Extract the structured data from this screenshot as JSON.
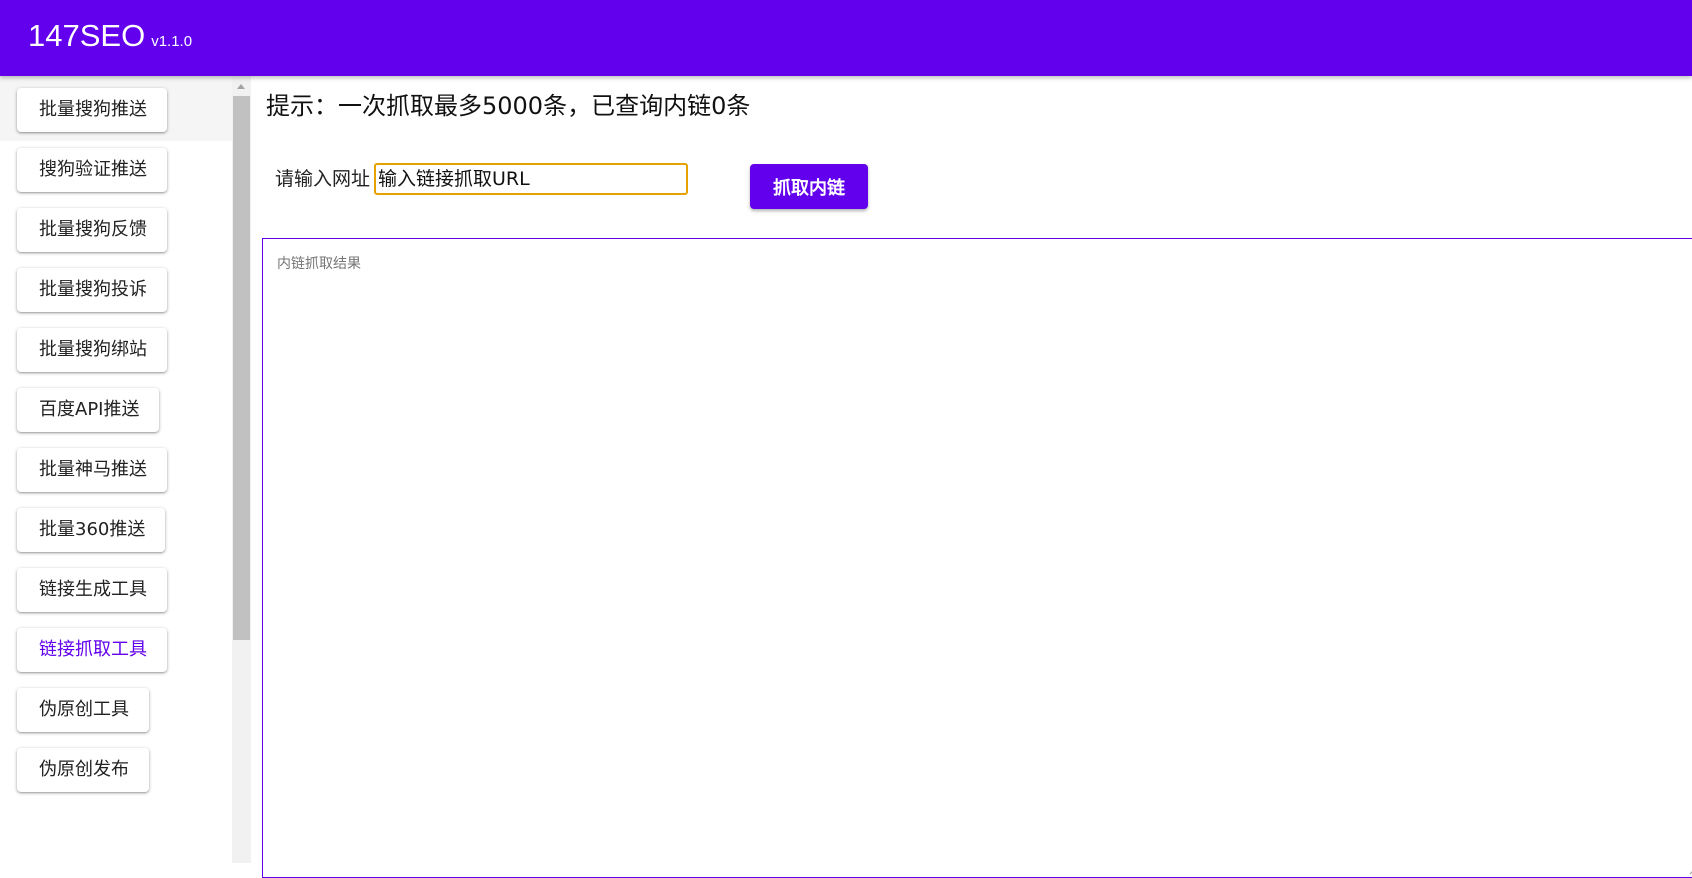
{
  "app": {
    "title": "147SEO",
    "version": "v1.1.0"
  },
  "sidebar": {
    "items": [
      {
        "label": "批量搜狗推送"
      },
      {
        "label": "搜狗验证推送"
      },
      {
        "label": "批量搜狗反馈"
      },
      {
        "label": "批量搜狗投诉"
      },
      {
        "label": "批量搜狗绑站"
      },
      {
        "label": "百度API推送"
      },
      {
        "label": "批量神马推送"
      },
      {
        "label": "批量360推送"
      },
      {
        "label": "链接生成工具"
      },
      {
        "label": "链接抓取工具"
      },
      {
        "label": "伪原创工具"
      },
      {
        "label": "伪原创发布"
      }
    ],
    "selected_label": "链接抓取工具"
  },
  "main": {
    "hint": "提示：一次抓取最多5000条，已查询内链0条",
    "url_label": "请输入网址",
    "url_input": {
      "placeholder": "输入链接抓取URL",
      "value": ""
    },
    "fetch_button_label": "抓取内链",
    "result_placeholder": "内链抓取结果"
  },
  "colors": {
    "accent": "#6200ee",
    "input_focus_border": "#e5a200"
  },
  "icons": {
    "scroll_up": "scroll-up-arrow-icon",
    "resize": "resize-grip-icon"
  }
}
